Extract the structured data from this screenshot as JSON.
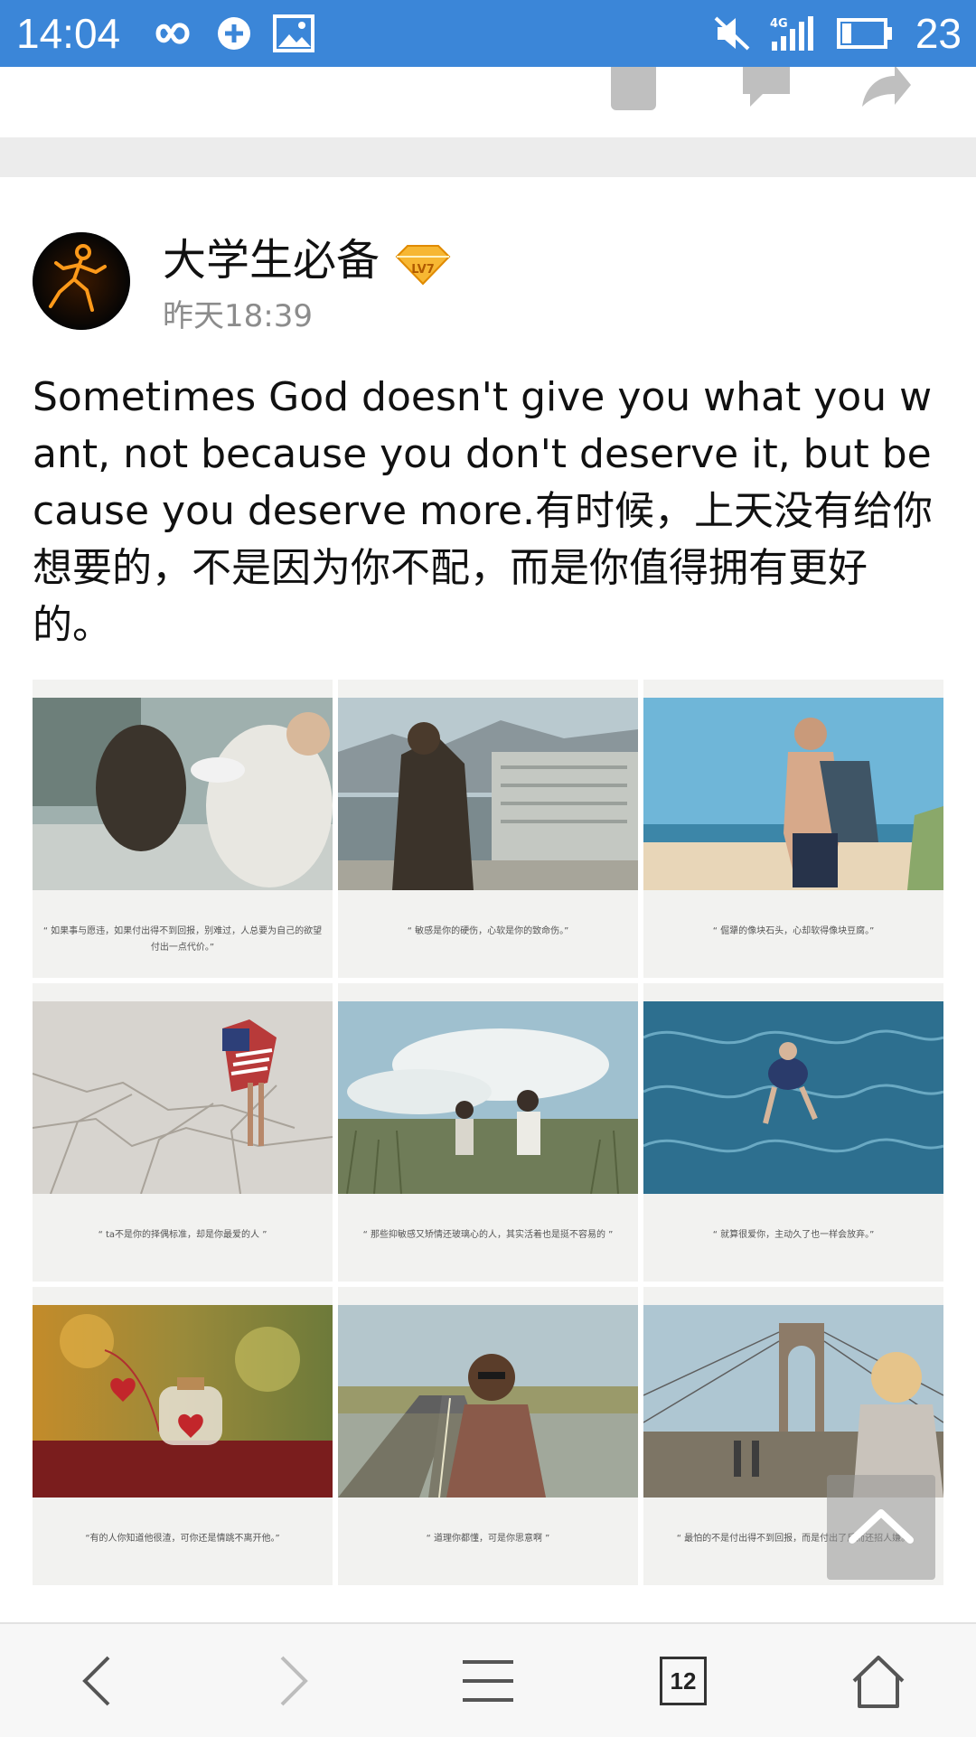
{
  "status_bar": {
    "time": "14:04",
    "battery": "23",
    "network": "4G",
    "icons": [
      "infinity-icon",
      "sync-icon",
      "image-icon",
      "mute-icon",
      "signal-icon",
      "battery-icon"
    ]
  },
  "prev_post_actions": [
    "like-icon",
    "comment-icon",
    "share-icon"
  ],
  "post": {
    "author": "大学生必备",
    "level": "LV7",
    "time": "昨天18:39",
    "text": "Sometimes God doesn't give you what you want, not because you don't deserve it, but because you deserve more.有时候，上天没有给你想要的，不是因为你不配，而是你值得拥有更好的。",
    "images": [
      {
        "caption": "“ 如果事与愿违，如果付出得不到回报，别难过，人总要为自己的欲望付出一点代价。”"
      },
      {
        "caption": "“ 敏感是你的硬伤，心软是你的致命伤。”"
      },
      {
        "caption": "“ 倔犟的像块石头，心却软得像块豆腐。”"
      },
      {
        "caption": "“ ta不是你的择偶标准，却是你最爱的人 ”"
      },
      {
        "caption": "“ 那些抑敏感又矫情还玻璃心的人，其实活着也是挺不容易的 ”"
      },
      {
        "caption": "“ 就算很爱你，主动久了也一样会放弃。”"
      },
      {
        "caption": "“有的人你知道他很渣，可你还是情跳不离开他。”"
      },
      {
        "caption": "“ 道理你都懂，可是你思意啊 ”"
      },
      {
        "caption": "“ 最怕的不是付出得不到回报，而是付出了反而还招人嫌。”"
      }
    ]
  },
  "bottom_nav": {
    "tab_count": "12",
    "items": [
      "back-icon",
      "forward-icon",
      "menu-icon",
      "tabs-icon",
      "home-icon"
    ]
  }
}
